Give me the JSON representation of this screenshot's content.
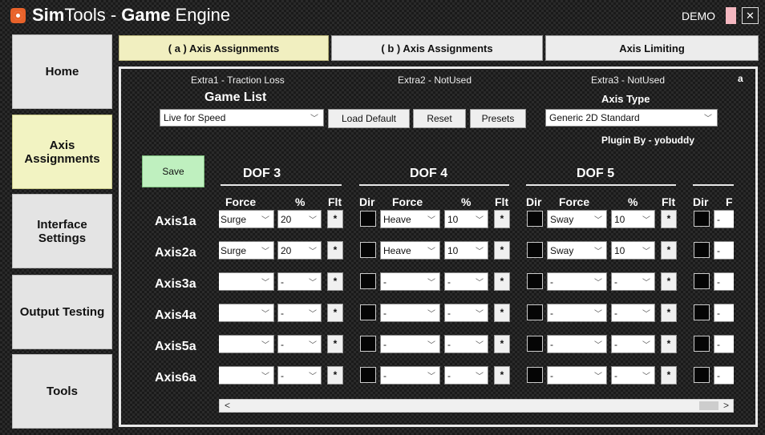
{
  "window": {
    "title_bold_1": "Sim",
    "title_light_1": "Tools",
    "title_sep": " - ",
    "title_bold_2": "Game",
    "title_light_2": " Engine",
    "demo_label": "DEMO",
    "close_label": "✕"
  },
  "colors": {
    "accent": "#f2f3c2",
    "save_green": "#bff0bf",
    "demo_pink": "#f4b7c0"
  },
  "sidebar": {
    "items": [
      {
        "label": "Home"
      },
      {
        "label": "Axis Assignments",
        "active": true
      },
      {
        "label": "Interface Settings"
      },
      {
        "label": "Output Testing"
      },
      {
        "label": "Tools"
      }
    ]
  },
  "tabs": [
    {
      "label": "( a ) Axis Assignments",
      "active": true
    },
    {
      "label": "( b ) Axis Assignments"
    },
    {
      "label": "Axis Limiting"
    }
  ],
  "panel": {
    "extra1": "Extra1 - Traction Loss",
    "extra2": "Extra2 - NotUsed",
    "extra3": "Extra3 - NotUsed",
    "corner": "a",
    "game_list_title": "Game List",
    "game_value": "Live for Speed",
    "load_default": "Load Default",
    "reset": "Reset",
    "presets": "Presets",
    "axis_type_title": "Axis Type",
    "axis_type_value": "Generic 2D Standard",
    "plugin_by": "Plugin By - yobuddy",
    "save": "Save"
  },
  "grid": {
    "dof_titles": [
      "DOF 3",
      "DOF 4",
      "DOF 5"
    ],
    "col_dir": "Dir",
    "col_force": "Force",
    "col_pct": "%",
    "col_flt": "Flt",
    "partial_force": "F",
    "axes": [
      "Axis1a",
      "Axis2a",
      "Axis3a",
      "Axis4a",
      "Axis5a",
      "Axis6a"
    ],
    "rows": [
      {
        "d3f": "Surge",
        "d3p": "20",
        "d4f": "Heave",
        "d4p": "10",
        "d5f": "Sway",
        "d5p": "10",
        "d6f": "-"
      },
      {
        "d3f": "Surge",
        "d3p": "20",
        "d4f": "Heave",
        "d4p": "10",
        "d5f": "Sway",
        "d5p": "10",
        "d6f": "-"
      },
      {
        "d3f": "",
        "d3p": "-",
        "d4f": "-",
        "d4p": "-",
        "d5f": "-",
        "d5p": "-",
        "d6f": "-"
      },
      {
        "d3f": "",
        "d3p": "-",
        "d4f": "-",
        "d4p": "-",
        "d5f": "-",
        "d5p": "-",
        "d6f": "-"
      },
      {
        "d3f": "",
        "d3p": "-",
        "d4f": "-",
        "d4p": "-",
        "d5f": "-",
        "d5p": "-",
        "d6f": "-"
      },
      {
        "d3f": "",
        "d3p": "-",
        "d4f": "-",
        "d4p": "-",
        "d5f": "-",
        "d5p": "-",
        "d6f": "-"
      }
    ],
    "flt_label": "*",
    "scroll_left": "<",
    "scroll_right": ">"
  }
}
